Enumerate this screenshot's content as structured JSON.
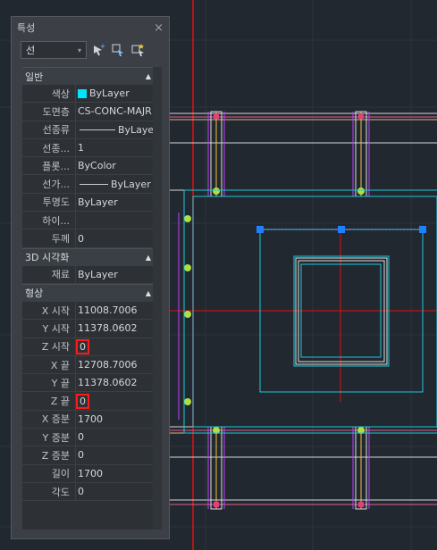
{
  "palette": {
    "title": "특성",
    "close_glyph": "×",
    "selector": {
      "value": "선"
    },
    "sections": {
      "general": {
        "label": "일반",
        "rows": [
          {
            "key": "색상",
            "value": "ByLayer"
          },
          {
            "key": "도면층",
            "value": "CS-CONC-MAJR"
          },
          {
            "key": "선종류",
            "value": "ByLayer"
          },
          {
            "key": "선종...",
            "value": "1"
          },
          {
            "key": "플롯...",
            "value": "ByColor"
          },
          {
            "key": "선가...",
            "value": "ByLayer"
          },
          {
            "key": "투명도",
            "value": "ByLayer"
          },
          {
            "key": "하이...",
            "value": ""
          },
          {
            "key": "두께",
            "value": "0"
          }
        ]
      },
      "visual3d": {
        "label": "3D 시각화",
        "rows": [
          {
            "key": "재료",
            "value": "ByLayer"
          }
        ]
      },
      "geometry": {
        "label": "형상",
        "rows": [
          {
            "key": "X 시작",
            "value": "11008.7006"
          },
          {
            "key": "Y 시작",
            "value": "11378.0602"
          },
          {
            "key": "Z 시작",
            "value": "0"
          },
          {
            "key": "X 끝",
            "value": "12708.7006"
          },
          {
            "key": "Y 끝",
            "value": "11378.0602"
          },
          {
            "key": "Z 끝",
            "value": "0"
          },
          {
            "key": "X 증분",
            "value": "1700"
          },
          {
            "key": "Y 증분",
            "value": "0"
          },
          {
            "key": "Z 증분",
            "value": "0"
          },
          {
            "key": "길이",
            "value": "1700"
          },
          {
            "key": "각도",
            "value": "0"
          }
        ]
      }
    }
  },
  "colors": {
    "highlight": "#ff1a1a",
    "swatch": "#00e5ff",
    "grip": "#1e7fff"
  }
}
